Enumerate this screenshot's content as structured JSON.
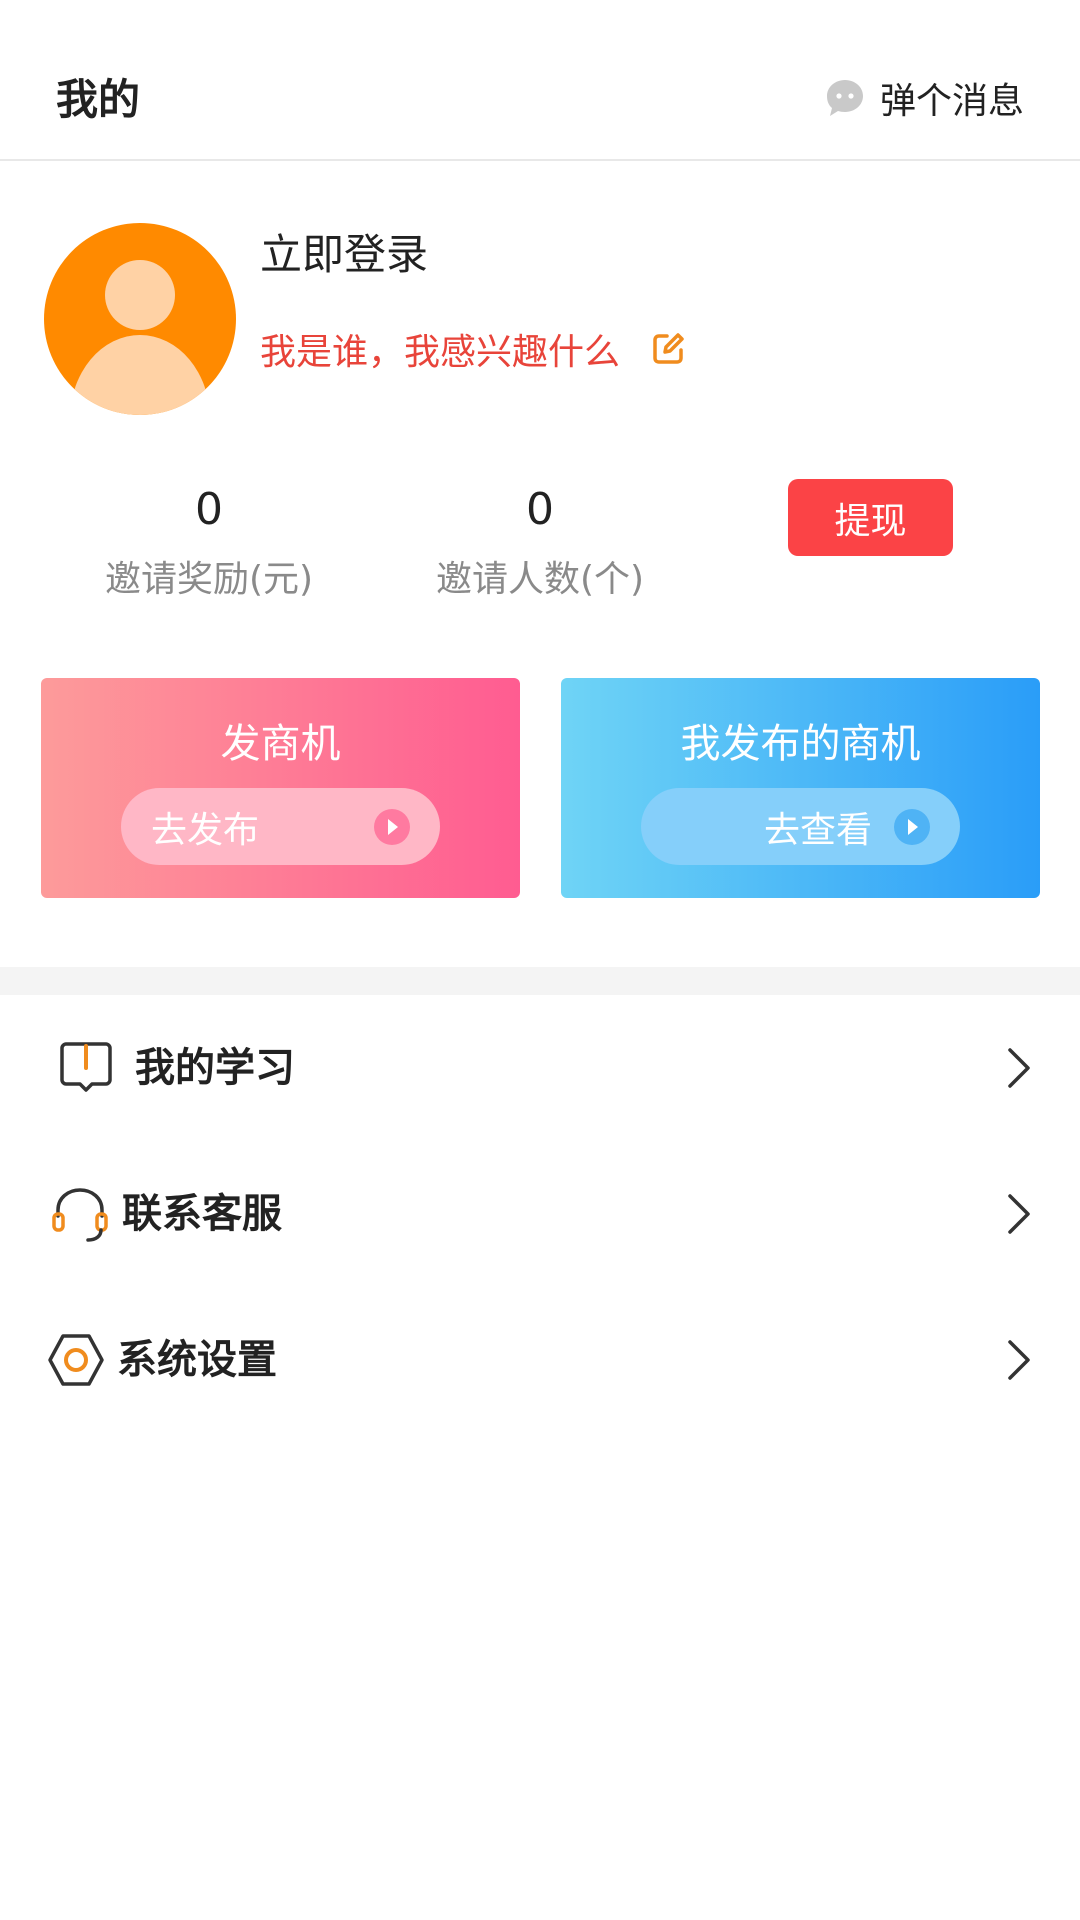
{
  "header": {
    "title": "我的",
    "message_label": "弹个消息",
    "message_icon": "chat-bubble-icon"
  },
  "profile": {
    "login_label": "立即登录",
    "bio": "我是谁，我感兴趣什么",
    "avatar_icon": "user-avatar-icon",
    "edit_icon": "edit-icon"
  },
  "stats": {
    "reward_value": "0",
    "reward_label": "邀请奖励(元)",
    "invites_value": "0",
    "invites_label": "邀请人数(个)",
    "withdraw_label": "提现"
  },
  "cards": {
    "post": {
      "title": "发商机",
      "action": "去发布"
    },
    "mine": {
      "title": "我发布的商机",
      "action": "去查看"
    }
  },
  "menu": {
    "items": [
      {
        "label": "我的学习",
        "icon": "book-icon"
      },
      {
        "label": "联系客服",
        "icon": "headset-icon"
      },
      {
        "label": "系统设置",
        "icon": "settings-icon"
      }
    ]
  },
  "colors": {
    "accent_red": "#fb4346",
    "bio_red": "#e8443a",
    "avatar_orange": "#ff8a00",
    "icon_orange": "#f08c1e",
    "card_pink_start": "#fd9b9a",
    "card_pink_end": "#ff5c91",
    "card_blue_start": "#6fd4f6",
    "card_blue_end": "#2a9df8"
  }
}
